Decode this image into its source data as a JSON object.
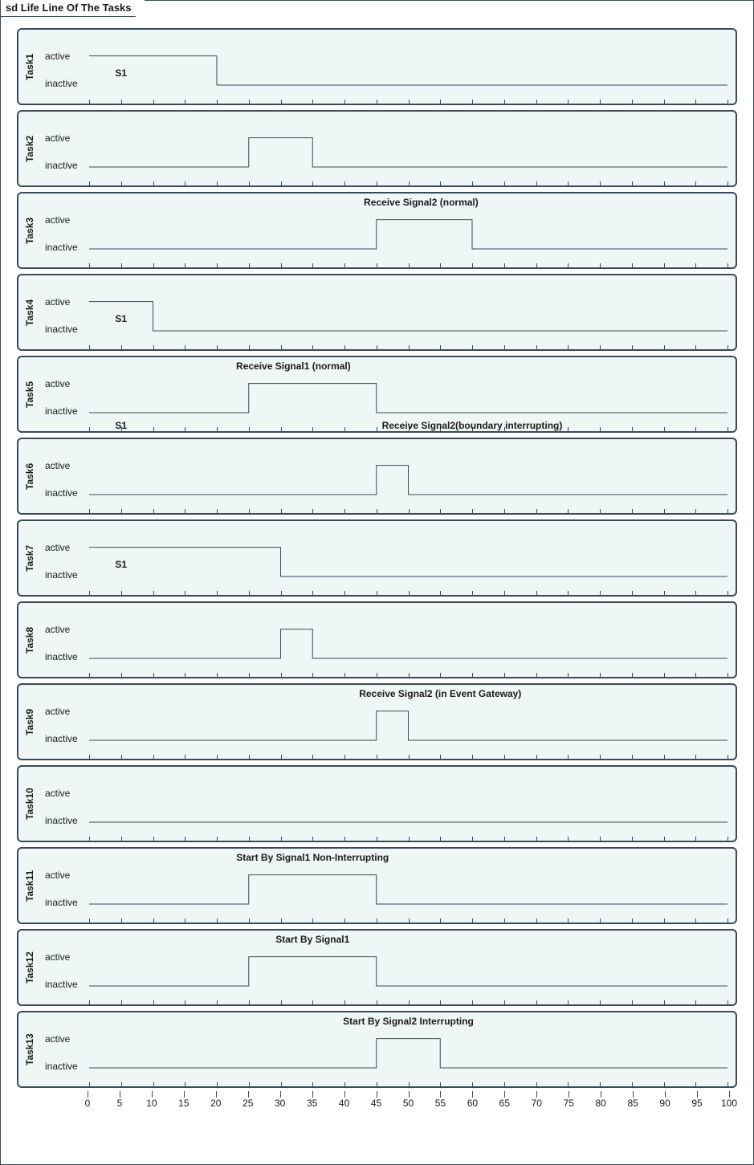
{
  "title": "sd Life Line Of The Tasks",
  "y_states": {
    "active": "active",
    "inactive": "inactive"
  },
  "x_axis": {
    "min": 0,
    "max": 100,
    "step": 5
  },
  "chart_data": {
    "type": "timing-diagram",
    "x_range": [
      0,
      100
    ],
    "levels": {
      "active": 1,
      "inactive": 0
    },
    "tracks": [
      {
        "name": "Task1",
        "segments": [
          {
            "from": 0,
            "to": 20,
            "level": "active"
          },
          {
            "from": 20,
            "to": 100,
            "level": "inactive"
          }
        ],
        "annotations": [
          {
            "text": "S1",
            "x": 5,
            "pos": "mid"
          }
        ]
      },
      {
        "name": "Task2",
        "segments": [
          {
            "from": 0,
            "to": 25,
            "level": "inactive"
          },
          {
            "from": 25,
            "to": 35,
            "level": "active"
          },
          {
            "from": 35,
            "to": 100,
            "level": "inactive"
          }
        ],
        "annotations": []
      },
      {
        "name": "Task3",
        "segments": [
          {
            "from": 0,
            "to": 45,
            "level": "inactive"
          },
          {
            "from": 45,
            "to": 60,
            "level": "active"
          },
          {
            "from": 60,
            "to": 100,
            "level": "inactive"
          }
        ],
        "annotations": [
          {
            "text": "Receive Signal2 (normal)",
            "x": 52,
            "pos": "top"
          }
        ]
      },
      {
        "name": "Task4",
        "segments": [
          {
            "from": 0,
            "to": 10,
            "level": "active"
          },
          {
            "from": 10,
            "to": 100,
            "level": "inactive"
          }
        ],
        "annotations": [
          {
            "text": "S1",
            "x": 5,
            "pos": "mid"
          }
        ]
      },
      {
        "name": "Task5",
        "segments": [
          {
            "from": 0,
            "to": 25,
            "level": "inactive"
          },
          {
            "from": 25,
            "to": 45,
            "level": "active"
          },
          {
            "from": 45,
            "to": 100,
            "level": "inactive"
          }
        ],
        "annotations": [
          {
            "text": "Receive Signal1 (normal)",
            "x": 32,
            "pos": "top"
          },
          {
            "text": "S1",
            "x": 5,
            "pos": "bottom"
          },
          {
            "text": "Receive Signal2(boundary interrupting)",
            "x": 60,
            "pos": "bottom"
          }
        ]
      },
      {
        "name": "Task6",
        "segments": [
          {
            "from": 0,
            "to": 45,
            "level": "inactive"
          },
          {
            "from": 45,
            "to": 50,
            "level": "active"
          },
          {
            "from": 50,
            "to": 100,
            "level": "inactive"
          }
        ],
        "annotations": []
      },
      {
        "name": "Task7",
        "segments": [
          {
            "from": 0,
            "to": 30,
            "level": "active"
          },
          {
            "from": 30,
            "to": 100,
            "level": "inactive"
          }
        ],
        "annotations": [
          {
            "text": "S1",
            "x": 5,
            "pos": "mid"
          }
        ]
      },
      {
        "name": "Task8",
        "segments": [
          {
            "from": 0,
            "to": 30,
            "level": "inactive"
          },
          {
            "from": 30,
            "to": 35,
            "level": "active"
          },
          {
            "from": 35,
            "to": 100,
            "level": "inactive"
          }
        ],
        "annotations": []
      },
      {
        "name": "Task9",
        "segments": [
          {
            "from": 0,
            "to": 45,
            "level": "inactive"
          },
          {
            "from": 45,
            "to": 50,
            "level": "active"
          },
          {
            "from": 50,
            "to": 100,
            "level": "inactive"
          }
        ],
        "annotations": [
          {
            "text": "Receive Signal2 (in Event Gateway)",
            "x": 55,
            "pos": "top"
          }
        ]
      },
      {
        "name": "Task10",
        "segments": [
          {
            "from": 0,
            "to": 100,
            "level": "inactive"
          }
        ],
        "annotations": []
      },
      {
        "name": "Task11",
        "segments": [
          {
            "from": 0,
            "to": 25,
            "level": "inactive"
          },
          {
            "from": 25,
            "to": 45,
            "level": "active"
          },
          {
            "from": 45,
            "to": 100,
            "level": "inactive"
          }
        ],
        "annotations": [
          {
            "text": "Start By Signal1 Non-Interrupting",
            "x": 35,
            "pos": "top"
          }
        ]
      },
      {
        "name": "Task12",
        "segments": [
          {
            "from": 0,
            "to": 25,
            "level": "inactive"
          },
          {
            "from": 25,
            "to": 45,
            "level": "active"
          },
          {
            "from": 45,
            "to": 100,
            "level": "inactive"
          }
        ],
        "annotations": [
          {
            "text": "Start By Signal1",
            "x": 35,
            "pos": "top"
          }
        ]
      },
      {
        "name": "Task13",
        "segments": [
          {
            "from": 0,
            "to": 45,
            "level": "inactive"
          },
          {
            "from": 45,
            "to": 55,
            "level": "active"
          },
          {
            "from": 55,
            "to": 100,
            "level": "inactive"
          }
        ],
        "annotations": [
          {
            "text": "Start By Signal2 Interrupting",
            "x": 50,
            "pos": "top"
          }
        ]
      }
    ]
  }
}
